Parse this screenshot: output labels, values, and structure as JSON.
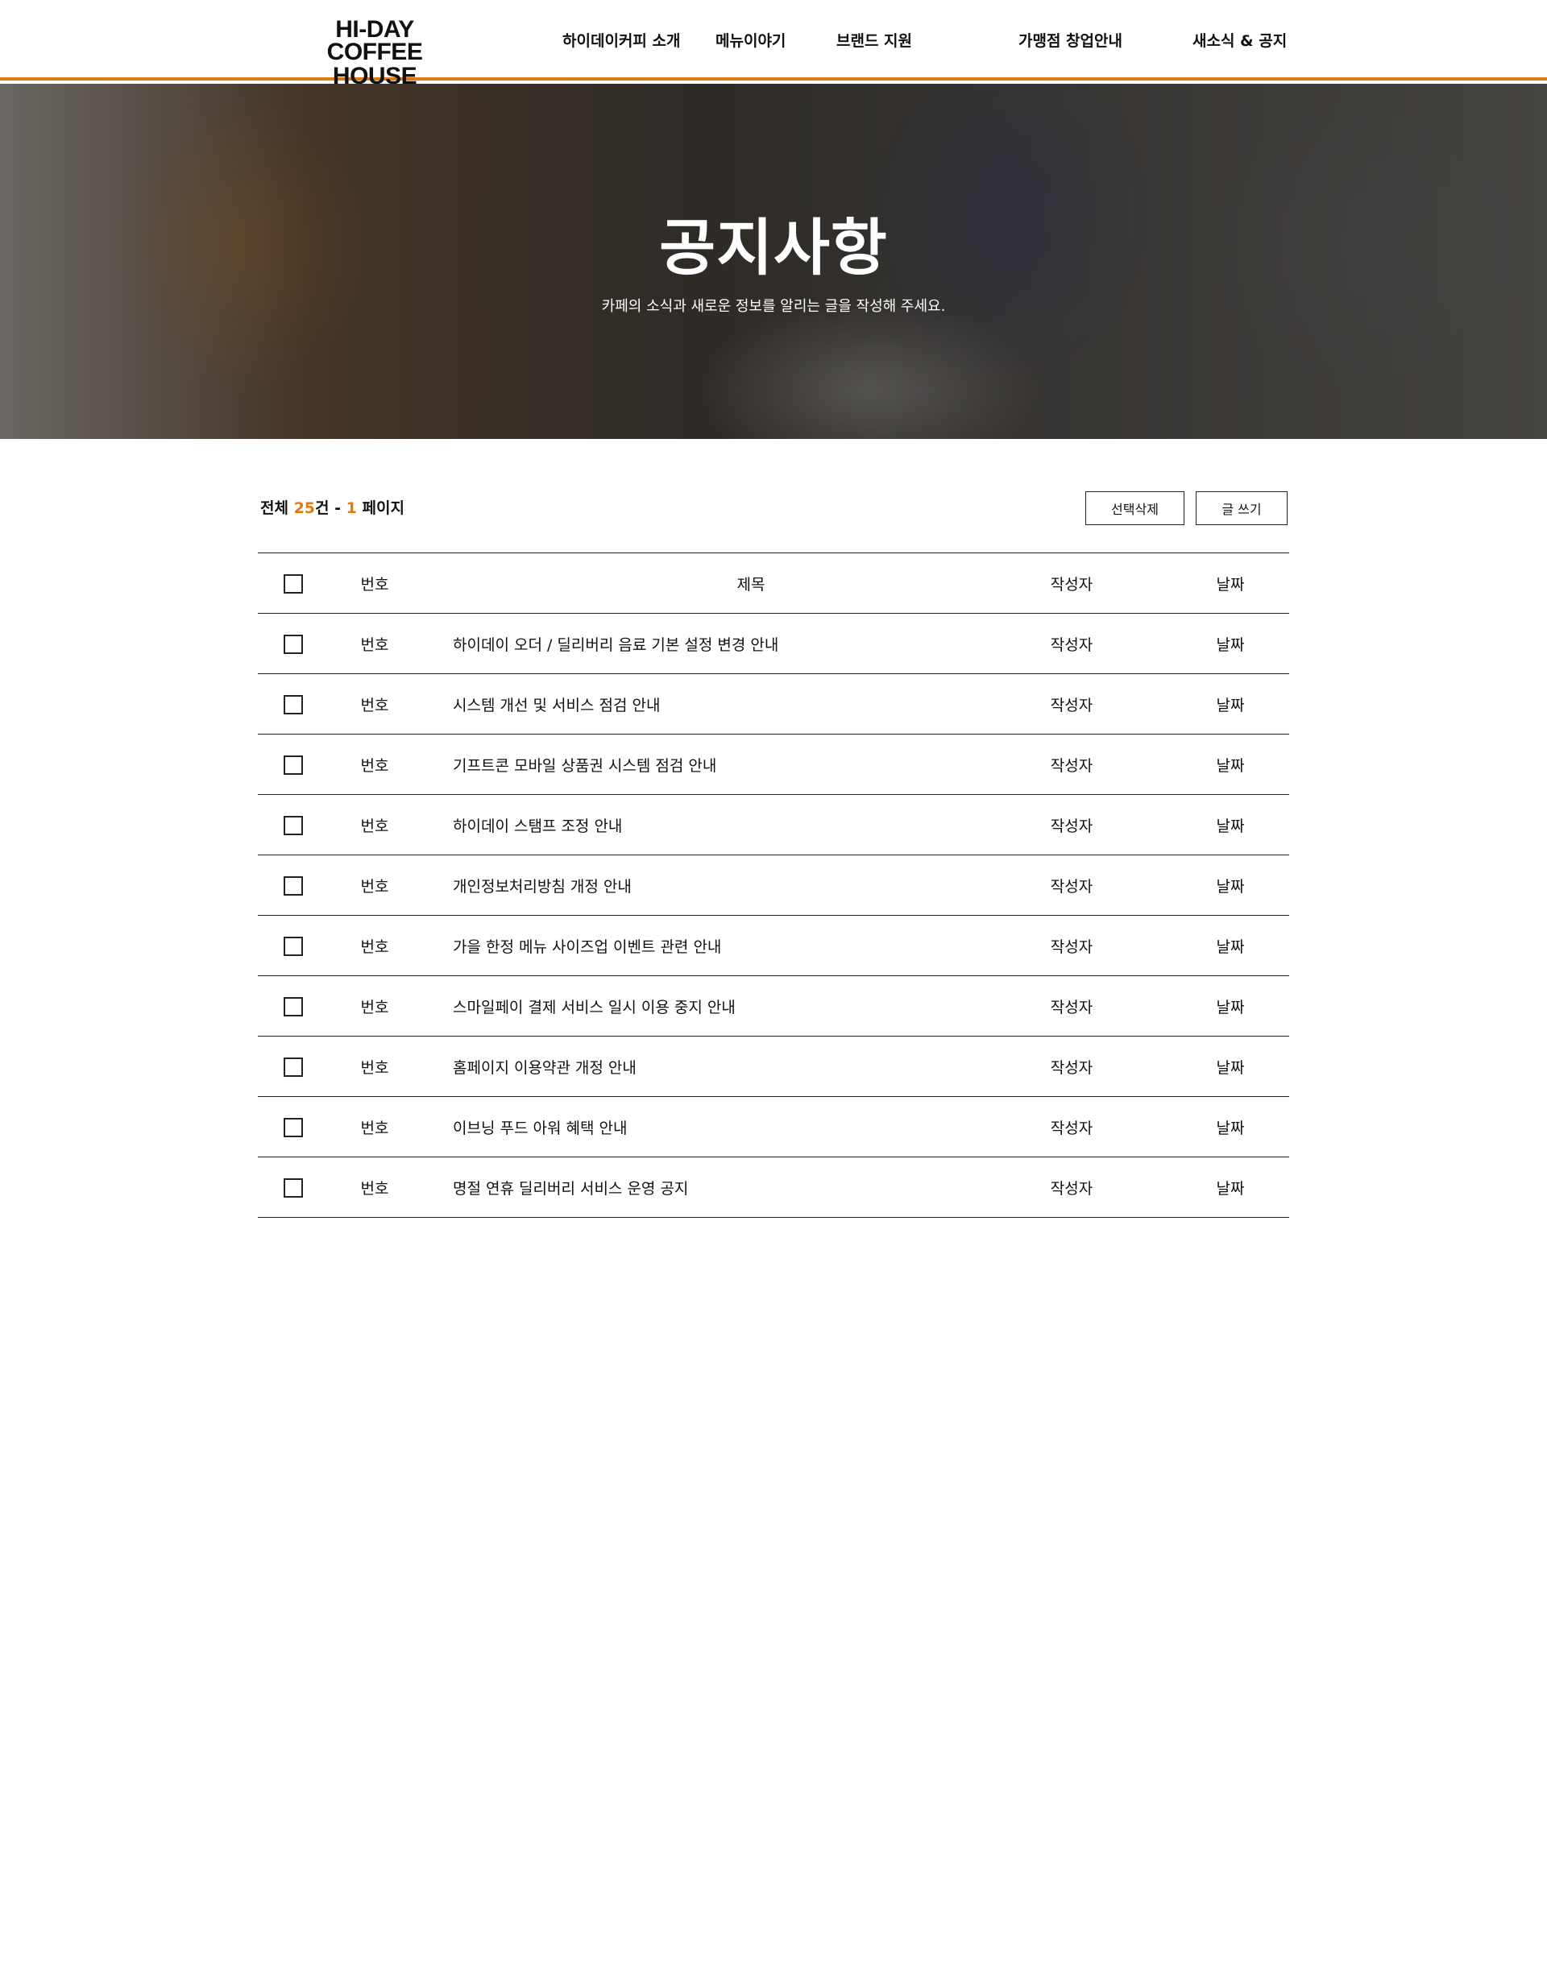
{
  "brand": {
    "logo_line1": "HI-DAY",
    "logo_line2": "COFFEE HOUSE",
    "accent_color": "#e07b10"
  },
  "nav": {
    "items": [
      {
        "label": "하이데이커피 소개"
      },
      {
        "label": "메뉴이야기"
      },
      {
        "label": "브랜드 지원"
      },
      {
        "label": "가맹점 창업안내"
      },
      {
        "label": "새소식 & 공지"
      }
    ]
  },
  "hero": {
    "title": "공지사항",
    "subtitle": "카페의 소식과 새로운 정보를 알리는 글을 작성해 주세요."
  },
  "board": {
    "total_prefix": "전체 ",
    "total_count": "25",
    "total_suffix": "건 - ",
    "page_number": "1",
    "page_suffix": " 페이지",
    "delete_button": "선택삭제",
    "write_button": "글 쓰기",
    "columns": {
      "number": "번호",
      "title": "제목",
      "author": "작성자",
      "date": "날짜"
    },
    "rows": [
      {
        "number": "번호",
        "title": "하이데이 오더 / 딜리버리 음료 기본 설정 변경 안내",
        "author": "작성자",
        "date": "날짜"
      },
      {
        "number": "번호",
        "title": "시스템 개선 및 서비스 점검 안내",
        "author": "작성자",
        "date": "날짜"
      },
      {
        "number": "번호",
        "title": "기프트콘 모바일 상품권 시스템 점검 안내",
        "author": "작성자",
        "date": "날짜"
      },
      {
        "number": "번호",
        "title": "하이데이 스탬프 조정 안내",
        "author": "작성자",
        "date": "날짜"
      },
      {
        "number": "번호",
        "title": "개인정보처리방침 개정 안내",
        "author": "작성자",
        "date": "날짜"
      },
      {
        "number": "번호",
        "title": "가을 한정 메뉴 사이즈업 이벤트 관련 안내",
        "author": "작성자",
        "date": "날짜"
      },
      {
        "number": "번호",
        "title": "스마일페이 결제 서비스 일시 이용 중지 안내",
        "author": "작성자",
        "date": "날짜"
      },
      {
        "number": "번호",
        "title": "홈페이지 이용약관 개정 안내",
        "author": "작성자",
        "date": "날짜"
      },
      {
        "number": "번호",
        "title": "이브닝 푸드 아워 혜택 안내",
        "author": "작성자",
        "date": "날짜"
      },
      {
        "number": "번호",
        "title": "명절 연휴 딜리버리 서비스 운영 공지",
        "author": "작성자",
        "date": "날짜"
      }
    ]
  }
}
